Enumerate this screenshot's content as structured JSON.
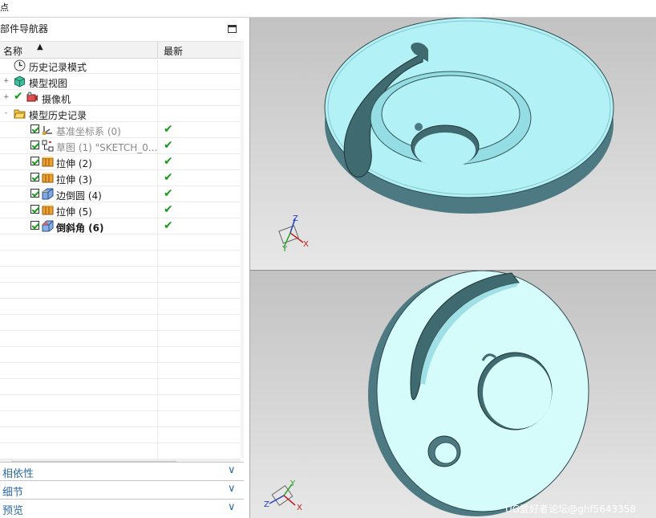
{
  "window": {
    "title_fragment": "点"
  },
  "navigator": {
    "title": "部件导航器",
    "columns": {
      "name": "名称",
      "latest": "最新"
    },
    "sort_indicator": "▲",
    "nodes": [
      {
        "label": "历史记录模式",
        "icon": "clock-icon",
        "expander": "",
        "checked": false,
        "latest": ""
      },
      {
        "label": "模型视图",
        "icon": "model-view-icon",
        "expander": "+",
        "checked": false,
        "latest": ""
      },
      {
        "label": "摄像机",
        "icon": "camera-icon",
        "expander": "+",
        "checked": false,
        "latest": ""
      },
      {
        "label": "模型历史记录",
        "icon": "folder-open-icon",
        "expander": "-",
        "checked": false,
        "latest": ""
      },
      {
        "label": "基准坐标系 (0)",
        "icon": "datum-csys-icon",
        "checked": true,
        "latest": "✔",
        "dim": true
      },
      {
        "label": "草图 (1) \"SKETCH_0...",
        "icon": "sketch-icon",
        "checked": true,
        "latest": "✔",
        "dim": true
      },
      {
        "label": "拉伸 (2)",
        "icon": "extrude-icon",
        "checked": true,
        "latest": "✔"
      },
      {
        "label": "拉伸 (3)",
        "icon": "extrude-icon",
        "checked": true,
        "latest": "✔"
      },
      {
        "label": "边倒圆 (4)",
        "icon": "edge-blend-icon",
        "checked": true,
        "latest": "✔"
      },
      {
        "label": "拉伸 (5)",
        "icon": "extrude-icon",
        "checked": true,
        "latest": "✔"
      },
      {
        "label": "倒斜角 (6)",
        "icon": "chamfer-icon",
        "checked": true,
        "latest": "✔",
        "bold": true
      }
    ],
    "panels": [
      {
        "label": "相依性",
        "chevron": "∨"
      },
      {
        "label": "细节",
        "chevron": "∨"
      },
      {
        "label": "预览",
        "chevron": "∨"
      }
    ],
    "scroll": {
      "left": "<",
      "right": ">"
    }
  },
  "viewports": {
    "top_axes": {
      "z": "Z",
      "y": "Y",
      "x": "X"
    },
    "bottom_axes": {
      "z": "Z",
      "y": "Y",
      "x": "X"
    },
    "watermark": "UG爱好者论坛@ghf5643358"
  },
  "colors": {
    "part_face": "#b2f2f6",
    "part_side": "#4d7a82",
    "check_green": "#1a9a1a",
    "panel_text": "#2b6aa3"
  }
}
